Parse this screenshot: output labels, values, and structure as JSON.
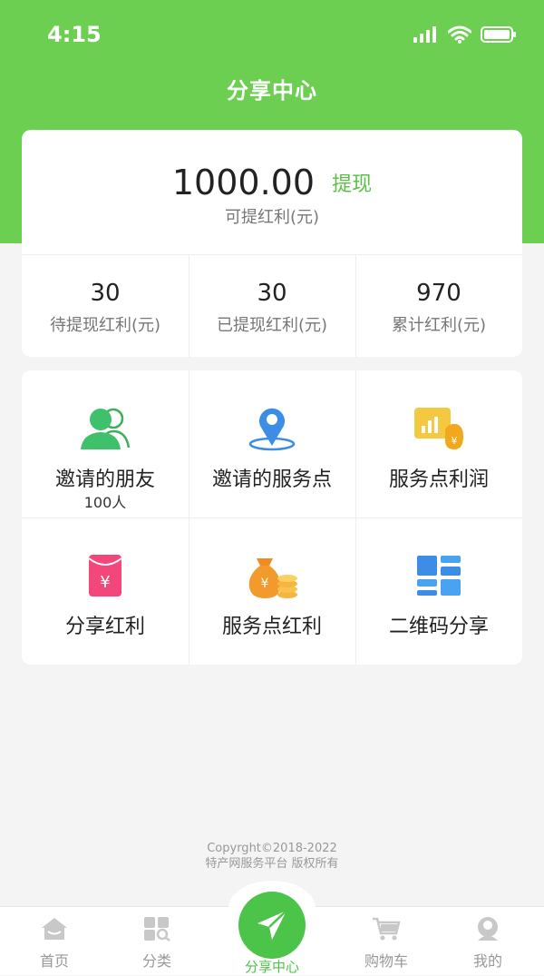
{
  "status": {
    "time": "4:15"
  },
  "header": {
    "title": "分享中心"
  },
  "summary": {
    "amount": "1000.00",
    "withdraw_label": "提现",
    "available_label": "可提红利(元)",
    "stats": [
      {
        "value": "30",
        "label": "待提现红利(元)"
      },
      {
        "value": "30",
        "label": "已提现红利(元)"
      },
      {
        "value": "970",
        "label": "累计红利(元)"
      }
    ]
  },
  "grid": [
    {
      "label": "邀请的朋友",
      "sub": "100人",
      "icon": "friends-icon"
    },
    {
      "label": "邀请的服务点",
      "sub": "",
      "icon": "location-icon"
    },
    {
      "label": "服务点利润",
      "sub": "",
      "icon": "profit-icon"
    },
    {
      "label": "分享红利",
      "sub": "",
      "icon": "red-packet-icon"
    },
    {
      "label": "服务点红利",
      "sub": "",
      "icon": "money-bag-icon"
    },
    {
      "label": "二维码分享",
      "sub": "",
      "icon": "qrcode-icon"
    }
  ],
  "footer": {
    "copyright": "Copyrght©2018-2022",
    "owner": "特产网服务平台 版权所有"
  },
  "tabbar": {
    "items": [
      {
        "label": "首页",
        "icon": "home-icon"
      },
      {
        "label": "分类",
        "icon": "category-icon"
      },
      {
        "label": "分享中心",
        "icon": "send-icon"
      },
      {
        "label": "购物车",
        "icon": "cart-icon"
      },
      {
        "label": "我的",
        "icon": "profile-icon"
      }
    ]
  },
  "colors": {
    "brand": "#6ccf52",
    "accent": "#5cbf45",
    "tab_active": "#4cc44a"
  }
}
